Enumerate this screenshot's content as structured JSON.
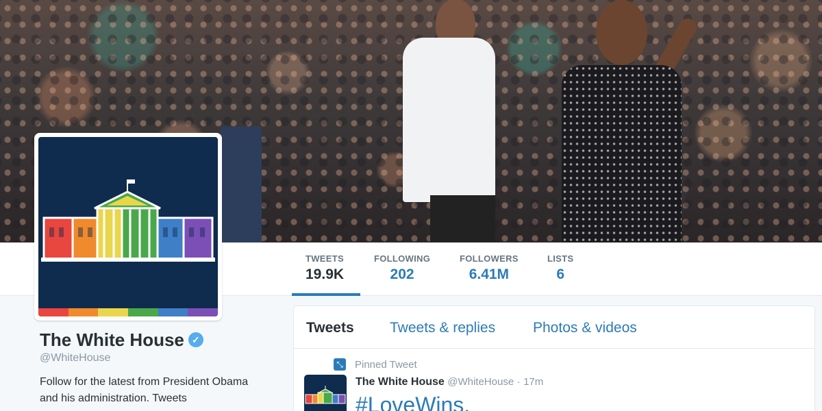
{
  "stats": [
    {
      "label": "TWEETS",
      "value": "19.9K",
      "active": true
    },
    {
      "label": "FOLLOWING",
      "value": "202"
    },
    {
      "label": "FOLLOWERS",
      "value": "6.41M"
    },
    {
      "label": "LISTS",
      "value": "6"
    }
  ],
  "profile": {
    "name": "The White House",
    "handle": "@WhiteHouse",
    "bio": "Follow for the latest from President Obama and his administration. Tweets",
    "verified_icon": "verified-check-icon"
  },
  "tabs": [
    {
      "label": "Tweets",
      "active": true
    },
    {
      "label": "Tweets & replies"
    },
    {
      "label": "Photos & videos"
    }
  ],
  "pinned_tweet": {
    "pinned_label": "Pinned Tweet",
    "author_name": "The White House",
    "author_handle": "@WhiteHouse",
    "separator": "·",
    "time": "17m",
    "text": "#LoveWins."
  },
  "colors": {
    "accent": "#2b7bb9",
    "text": "#292f33",
    "muted": "#8899a6",
    "avatar_bg": "#0f2b4e",
    "rainbow": [
      "#e8463e",
      "#f08a2c",
      "#e9d64b",
      "#4aa84b",
      "#3f7fc7",
      "#7b4fb5"
    ]
  }
}
